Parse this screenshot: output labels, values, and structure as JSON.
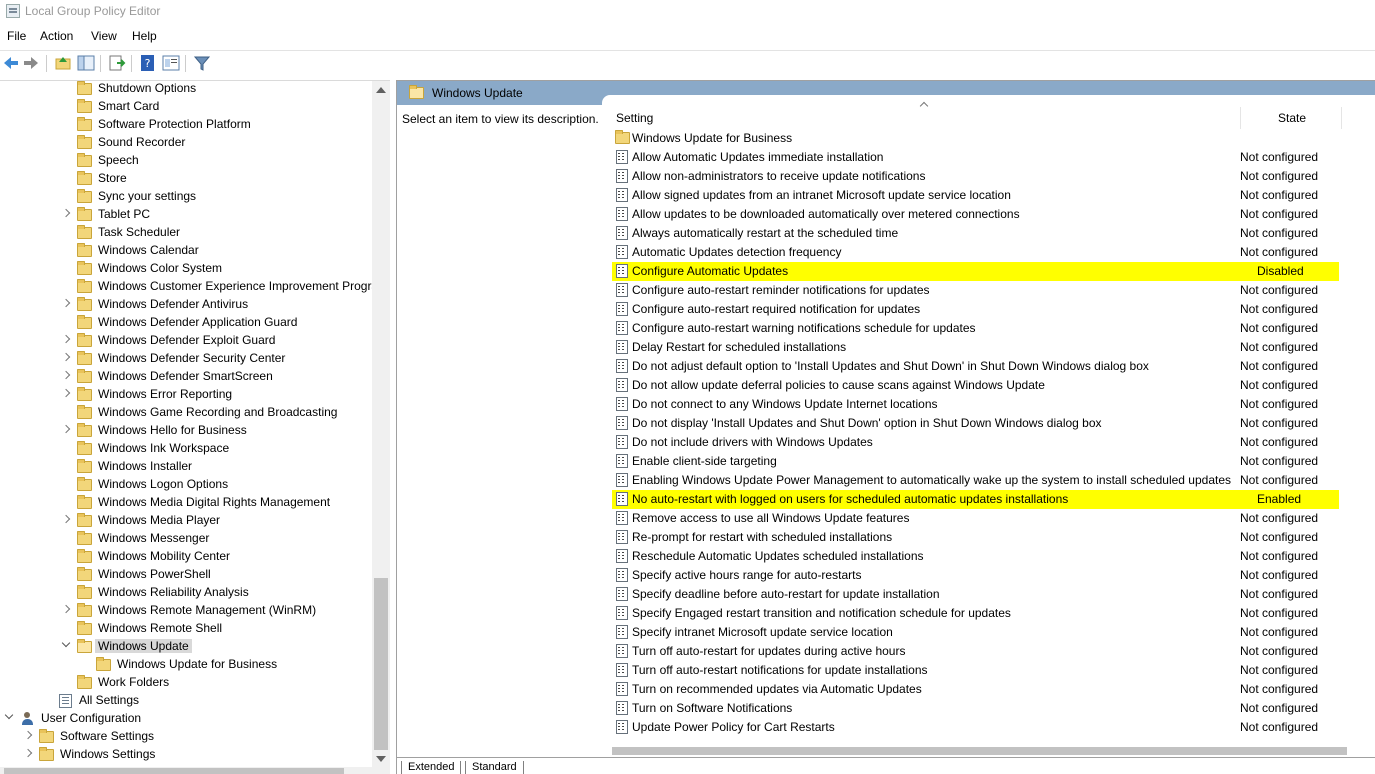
{
  "window": {
    "title": "Local Group Policy Editor"
  },
  "menu": [
    "File",
    "Action",
    "View",
    "Help"
  ],
  "tree": [
    {
      "label": "Shutdown Options",
      "expander": "none"
    },
    {
      "label": "Smart Card",
      "expander": "none"
    },
    {
      "label": "Software Protection Platform",
      "expander": "none"
    },
    {
      "label": "Sound Recorder",
      "expander": "none"
    },
    {
      "label": "Speech",
      "expander": "none"
    },
    {
      "label": "Store",
      "expander": "none"
    },
    {
      "label": "Sync your settings",
      "expander": "none"
    },
    {
      "label": "Tablet PC",
      "expander": "closed"
    },
    {
      "label": "Task Scheduler",
      "expander": "none"
    },
    {
      "label": "Windows Calendar",
      "expander": "none"
    },
    {
      "label": "Windows Color System",
      "expander": "none"
    },
    {
      "label": "Windows Customer Experience Improvement Progra",
      "expander": "none"
    },
    {
      "label": "Windows Defender Antivirus",
      "expander": "closed"
    },
    {
      "label": "Windows Defender Application Guard",
      "expander": "none"
    },
    {
      "label": "Windows Defender Exploit Guard",
      "expander": "closed"
    },
    {
      "label": "Windows Defender Security Center",
      "expander": "closed"
    },
    {
      "label": "Windows Defender SmartScreen",
      "expander": "closed"
    },
    {
      "label": "Windows Error Reporting",
      "expander": "closed"
    },
    {
      "label": "Windows Game Recording and Broadcasting",
      "expander": "none"
    },
    {
      "label": "Windows Hello for Business",
      "expander": "closed"
    },
    {
      "label": "Windows Ink Workspace",
      "expander": "none"
    },
    {
      "label": "Windows Installer",
      "expander": "none"
    },
    {
      "label": "Windows Logon Options",
      "expander": "none"
    },
    {
      "label": "Windows Media Digital Rights Management",
      "expander": "none"
    },
    {
      "label": "Windows Media Player",
      "expander": "closed"
    },
    {
      "label": "Windows Messenger",
      "expander": "none"
    },
    {
      "label": "Windows Mobility Center",
      "expander": "none"
    },
    {
      "label": "Windows PowerShell",
      "expander": "none"
    },
    {
      "label": "Windows Reliability Analysis",
      "expander": "none"
    },
    {
      "label": "Windows Remote Management (WinRM)",
      "expander": "closed"
    },
    {
      "label": "Windows Remote Shell",
      "expander": "none"
    },
    {
      "label": "Windows Update",
      "expander": "open",
      "selected": true
    },
    {
      "label": "Windows Update for Business",
      "expander": "none",
      "child": true
    },
    {
      "label": "Work Folders",
      "expander": "none"
    },
    {
      "label": "All Settings",
      "expander": "none",
      "icon": "settings-icon",
      "level": 2
    },
    {
      "label": "User Configuration",
      "expander": "open",
      "icon": "user-icon",
      "level": 0
    },
    {
      "label": "Software Settings",
      "expander": "closed",
      "level": 1
    },
    {
      "label": "Windows Settings",
      "expander": "closed",
      "level": 1
    }
  ],
  "right_pane": {
    "header": "Windows Update",
    "description": "Select an item to view its description.",
    "col_setting": "Setting",
    "col_state": "State",
    "highlight_color": "#ffff00",
    "rows": [
      {
        "label": "Windows Update for Business",
        "state": "",
        "type": "folder"
      },
      {
        "label": "Allow Automatic Updates immediate installation",
        "state": "Not configured"
      },
      {
        "label": "Allow non-administrators to receive update notifications",
        "state": "Not configured"
      },
      {
        "label": "Allow signed updates from an intranet Microsoft update service location",
        "state": "Not configured"
      },
      {
        "label": "Allow updates to be downloaded automatically over metered connections",
        "state": "Not configured"
      },
      {
        "label": "Always automatically restart at the scheduled time",
        "state": "Not configured"
      },
      {
        "label": "Automatic Updates detection frequency",
        "state": "Not configured"
      },
      {
        "label": "Configure Automatic Updates",
        "state": "Disabled",
        "highlight": true
      },
      {
        "label": "Configure auto-restart reminder notifications for updates",
        "state": "Not configured"
      },
      {
        "label": "Configure auto-restart required notification for updates",
        "state": "Not configured"
      },
      {
        "label": "Configure auto-restart warning notifications schedule for updates",
        "state": "Not configured"
      },
      {
        "label": "Delay Restart for scheduled installations",
        "state": "Not configured"
      },
      {
        "label": "Do not adjust default option to 'Install Updates and Shut Down' in Shut Down Windows dialog box",
        "state": "Not configured"
      },
      {
        "label": "Do not allow update deferral policies to cause scans against Windows Update",
        "state": "Not configured"
      },
      {
        "label": "Do not connect to any Windows Update Internet locations",
        "state": "Not configured"
      },
      {
        "label": "Do not display 'Install Updates and Shut Down' option in Shut Down Windows dialog box",
        "state": "Not configured"
      },
      {
        "label": "Do not include drivers with Windows Updates",
        "state": "Not configured"
      },
      {
        "label": "Enable client-side targeting",
        "state": "Not configured"
      },
      {
        "label": "Enabling Windows Update Power Management to automatically wake up the system to install scheduled updates",
        "state": "Not configured"
      },
      {
        "label": "No auto-restart with logged on users for scheduled automatic updates installations",
        "state": "Enabled",
        "highlight": true
      },
      {
        "label": "Remove access to use all Windows Update features",
        "state": "Not configured"
      },
      {
        "label": "Re-prompt for restart with scheduled installations",
        "state": "Not configured"
      },
      {
        "label": "Reschedule Automatic Updates scheduled installations",
        "state": "Not configured"
      },
      {
        "label": "Specify active hours range for auto-restarts",
        "state": "Not configured"
      },
      {
        "label": "Specify deadline before auto-restart for update installation",
        "state": "Not configured"
      },
      {
        "label": "Specify Engaged restart transition and notification schedule for updates",
        "state": "Not configured"
      },
      {
        "label": "Specify intranet Microsoft update service location",
        "state": "Not configured"
      },
      {
        "label": "Turn off auto-restart for updates during active hours",
        "state": "Not configured"
      },
      {
        "label": "Turn off auto-restart notifications for update installations",
        "state": "Not configured"
      },
      {
        "label": "Turn on recommended updates via Automatic Updates",
        "state": "Not configured"
      },
      {
        "label": "Turn on Software Notifications",
        "state": "Not configured"
      },
      {
        "label": "Update Power Policy for Cart Restarts",
        "state": "Not configured"
      }
    ],
    "tabs": [
      "Extended",
      "Standard"
    ]
  }
}
